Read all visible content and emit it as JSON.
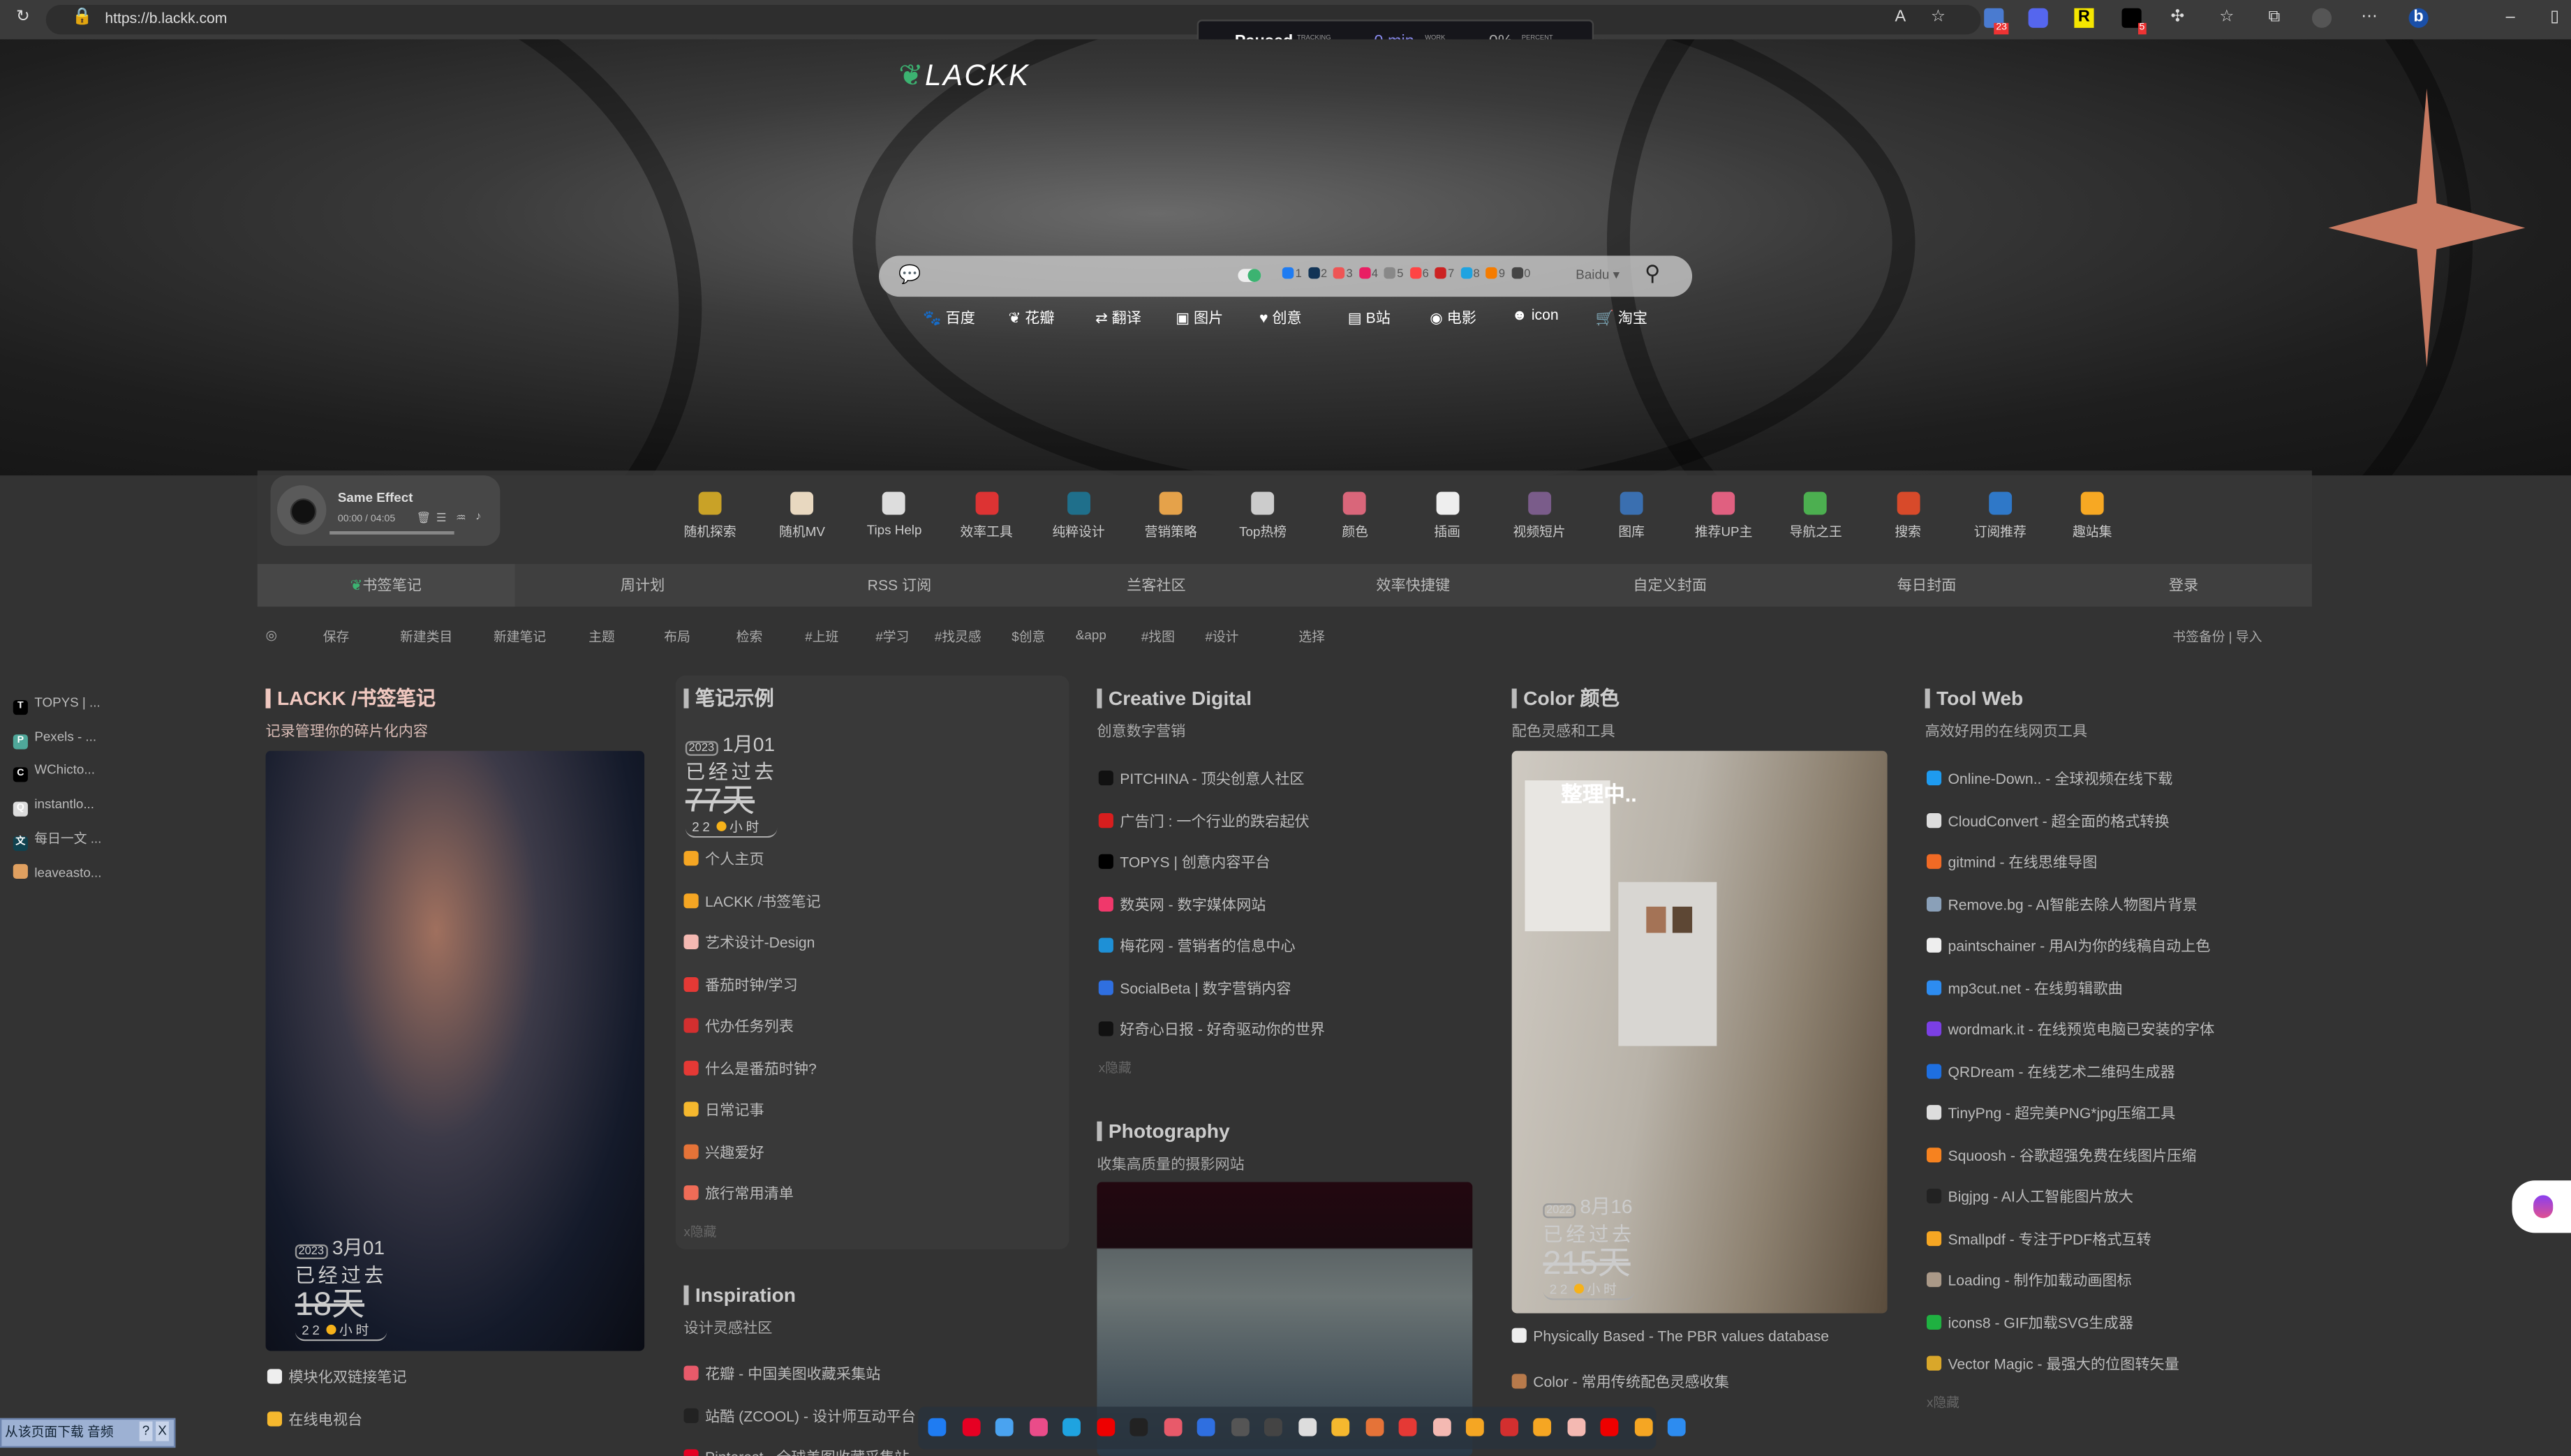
{
  "browser": {
    "url": "https://b.lackk.com",
    "extension_badges": [
      "23",
      "5"
    ],
    "timer": {
      "status": "Paused",
      "status_label": "TRACKING STATUS",
      "work": "0 min",
      "work_label": "WORK HOURS",
      "percent": "0%",
      "percent_label": "PERCENT OF DAY"
    }
  },
  "hero": {
    "logo": "LACKK",
    "search": {
      "placeholder": "",
      "engine": "Baidu",
      "engine_shortcuts": [
        "1",
        "2",
        "3",
        "4",
        "5",
        "6",
        "7",
        "8",
        "9",
        "0"
      ],
      "engine_colors": [
        "#1f7cf2",
        "#123456",
        "#e55",
        "#e91e63",
        "#888",
        "#f44",
        "#c22",
        "#1fa3e0",
        "#f57c00",
        "#444"
      ]
    },
    "quick_links": [
      "百度",
      "花瓣",
      "翻译",
      "图片",
      "创意",
      "B站",
      "电影",
      "icon",
      "淘宝"
    ]
  },
  "player": {
    "title": "Same Effect",
    "time": "00:00 / 04:05",
    "progress": 0
  },
  "nav_icons": [
    {
      "label": "随机探索",
      "color": "#c9a227"
    },
    {
      "label": "随机MV",
      "color": "#e8d8c0"
    },
    {
      "label": "Tips Help",
      "color": "#ddd"
    },
    {
      "label": "效率工具",
      "color": "#d33"
    },
    {
      "label": "纯粹设计",
      "color": "#1f6f8b"
    },
    {
      "label": "营销策略",
      "color": "#e5a24a"
    },
    {
      "label": "Top热榜",
      "color": "#ccc"
    },
    {
      "label": "颜色",
      "color": "#d9667a"
    },
    {
      "label": "插画",
      "color": "#eee"
    },
    {
      "label": "视频短片",
      "color": "#7a5c8a"
    },
    {
      "label": "图库",
      "color": "#3a6fb0"
    },
    {
      "label": "推荐UP主",
      "color": "#e06080"
    },
    {
      "label": "导航之王",
      "color": "#4caf50"
    },
    {
      "label": "搜索",
      "color": "#d84a2a"
    },
    {
      "label": "订阅推荐",
      "color": "#2f78c8"
    },
    {
      "label": "趣站集",
      "color": "#f7a823"
    }
  ],
  "tabs": [
    "书签笔记",
    "周计划",
    "RSS 订阅",
    "兰客社区",
    "效率快捷键",
    "自定义封面",
    "每日封面",
    "登录"
  ],
  "active_tab": "书签笔记",
  "toolbar": [
    "保存",
    "新建类目",
    "新建笔记",
    "主题",
    "布局",
    "检索",
    "#上班",
    "#学习",
    "#找灵感",
    "$创意",
    "&app",
    "#找图",
    "#设计",
    "选择"
  ],
  "toolbar_right": "书签备份 | 导入",
  "sidebar": [
    {
      "label": "TOPYS | ...",
      "icon": "T",
      "color": "#000"
    },
    {
      "label": "Pexels - ...",
      "icon": "P",
      "color": "#4fa89a"
    },
    {
      "label": "WChicto...",
      "icon": "C",
      "color": "#000"
    },
    {
      "label": "instantlo...",
      "icon": "Q",
      "color": "#ddd"
    },
    {
      "label": "每日一文 ...",
      "icon": "文",
      "color": "#10424f"
    },
    {
      "label": "leaveasto...",
      "icon": "",
      "color": "#e0a060"
    }
  ],
  "columns": {
    "lackk": {
      "title": "LACKK /书签笔记",
      "subtitle": "记录管理你的碎片化内容",
      "countdown": {
        "year": "2023",
        "date": "3月01",
        "passed": "已经过去",
        "days": "18天",
        "hours": "22",
        "hours_unit": "小时"
      },
      "items": [
        {
          "label": "模块化双链接笔记",
          "color": "#eee"
        },
        {
          "label": "在线电视台",
          "color": "#f5b82e"
        }
      ]
    },
    "notes": {
      "title": "笔记示例",
      "countdown": {
        "year": "2023",
        "date": "1月01",
        "passed": "已经过去",
        "days": "77天",
        "hours": "22",
        "hours_unit": "小时"
      },
      "items": [
        {
          "label": "个人主页",
          "color": "#f5a623"
        },
        {
          "label": "LACKK /书签笔记",
          "color": "#f5a623"
        },
        {
          "label": "艺术设计-Design",
          "color": "#f4b9b2"
        },
        {
          "label": "番茄时钟/学习",
          "color": "#e53935"
        },
        {
          "label": "代办任务列表",
          "color": "#d32f2f"
        },
        {
          "label": "什么是番茄时钟?",
          "color": "#e53935"
        },
        {
          "label": "日常记事",
          "color": "#f5b82e"
        },
        {
          "label": "兴趣爱好",
          "color": "#e57338"
        },
        {
          "label": "旅行常用清单",
          "color": "#ef6c57"
        }
      ],
      "hide": "x隐藏"
    },
    "inspiration": {
      "title": "Inspiration",
      "subtitle": "设计灵感社区",
      "items": [
        {
          "label": "花瓣 - 中国美图收藏采集站",
          "color": "#e85a6a"
        },
        {
          "label": "站酷 (ZCOOL) - 设计师互动平台",
          "color": "#222"
        },
        {
          "label": "Pinterest - 全球美图收藏采集站",
          "color": "#e60023"
        }
      ]
    },
    "creative": {
      "title": "Creative Digital",
      "subtitle": "创意数字营销",
      "items": [
        {
          "label": "PITCHINA - 顶尖创意人社区",
          "color": "#111"
        },
        {
          "label": "广告门 : 一个行业的跌宕起伏",
          "color": "#d81e1e"
        },
        {
          "label": "TOPYS | 创意内容平台",
          "color": "#000"
        },
        {
          "label": "数英网 - 数字媒体网站",
          "color": "#f0386b"
        },
        {
          "label": "梅花网 -  营销者的信息中心",
          "color": "#1e90d6"
        },
        {
          "label": "SocialBeta | 数字营销内容",
          "color": "#2f6fe0"
        },
        {
          "label": "好奇心日报 - 好奇驱动你的世界",
          "color": "#111"
        }
      ],
      "hide": "x隐藏"
    },
    "photography": {
      "title": "Photography",
      "subtitle": "收集高质量的摄影网站"
    },
    "color": {
      "title": "Color 颜色",
      "subtitle": "配色灵感和工具",
      "overlay": "整理中..",
      "countdown": {
        "year": "2022",
        "date": "8月16",
        "passed": "已经过去",
        "days": "215天",
        "hours": "22",
        "hours_unit": "小时"
      },
      "items": [
        {
          "label": "Physically Based - The PBR values database",
          "color": "#eee"
        },
        {
          "label": "Color - 常用传统配色灵感收集",
          "color": "#b87a4b"
        }
      ]
    },
    "tool": {
      "title": "Tool Web",
      "subtitle": "高效好用的在线网页工具",
      "items": [
        {
          "label": "Online-Down.. - 全球视频在线下载",
          "color": "#1e9bf0"
        },
        {
          "label": "CloudConvert - 超全面的格式转换",
          "color": "#ddd"
        },
        {
          "label": "gitmind - 在线思维导图",
          "color": "#f06a25"
        },
        {
          "label": "Remove.bg - AI智能去除人物图片背景",
          "color": "#8aa0b8"
        },
        {
          "label": "paintschainer - 用AI为你的线稿自动上色",
          "color": "#eee"
        },
        {
          "label": "mp3cut.net - 在线剪辑歌曲",
          "color": "#2d8cf0"
        },
        {
          "label": "wordmark.it - 在线预览电脑已安装的字体",
          "color": "#7b3fe4"
        },
        {
          "label": "QRDream - 在线艺术二维码生成器",
          "color": "#1e6fe0"
        },
        {
          "label": "TinyPng - 超完美PNG*jpg压缩工具",
          "color": "#ddd"
        },
        {
          "label": "Squoosh - 谷歌超强免费在线图片压缩",
          "color": "#f6821f"
        },
        {
          "label": "Bigjpg - AI人工智能图片放大",
          "color": "#222"
        },
        {
          "label": "Smallpdf - 专注于PDF格式互转",
          "color": "#f5a623"
        },
        {
          "label": "Loading - 制作加载动画图标",
          "color": "#a98"
        },
        {
          "label": "icons8 - GIF加载SVG生成器",
          "color": "#1fb141"
        },
        {
          "label": "Vector Magic - 最强大的位图转矢量",
          "color": "#d9a72a"
        }
      ],
      "hide": "x隐藏"
    }
  },
  "bottom_dock_colors": [
    "#1f7cf2",
    "#e60023",
    "#4aa3f0",
    "#ea4c89",
    "#1fa3e0",
    "#e00",
    "#222",
    "#e85a6a",
    "#2f6fe0",
    "#555",
    "#444",
    "#ddd",
    "#f5b82e",
    "#e57338",
    "#e53935",
    "#f4b9b2",
    "#f5a623",
    "#d32f2f",
    "#f5a623",
    "#f4b9b2",
    "#e00",
    "#f5a623",
    "#2d8cf0"
  ],
  "download_popup": {
    "label": "从该页面下载 音频",
    "help": "?",
    "close": "X"
  },
  "accent": "#3cb371"
}
